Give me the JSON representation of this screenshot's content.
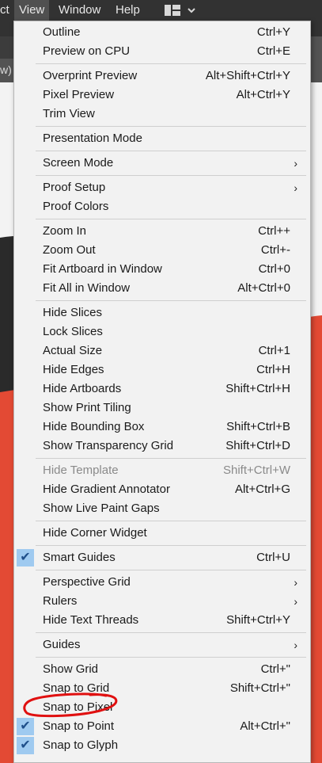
{
  "menubar": {
    "items": [
      "ct",
      "View",
      "Window",
      "Help"
    ],
    "active": "View"
  },
  "tab_strip_fragment": "w)",
  "view_menu": {
    "items": [
      {
        "label": "Outline",
        "shortcut": "Ctrl+Y"
      },
      {
        "label": "Preview on CPU",
        "shortcut": "Ctrl+E"
      },
      {
        "separator": true
      },
      {
        "label": "Overprint Preview",
        "shortcut": "Alt+Shift+Ctrl+Y"
      },
      {
        "label": "Pixel Preview",
        "shortcut": "Alt+Ctrl+Y"
      },
      {
        "label": "Trim View",
        "shortcut": ""
      },
      {
        "separator": true
      },
      {
        "label": "Presentation Mode",
        "shortcut": ""
      },
      {
        "separator": true
      },
      {
        "label": "Screen Mode",
        "submenu": true
      },
      {
        "separator": true
      },
      {
        "label": "Proof Setup",
        "submenu": true
      },
      {
        "label": "Proof Colors",
        "shortcut": ""
      },
      {
        "separator": true
      },
      {
        "label": "Zoom In",
        "shortcut": "Ctrl++"
      },
      {
        "label": "Zoom Out",
        "shortcut": "Ctrl+-"
      },
      {
        "label": "Fit Artboard in Window",
        "shortcut": "Ctrl+0"
      },
      {
        "label": "Fit All in Window",
        "shortcut": "Alt+Ctrl+0"
      },
      {
        "separator": true
      },
      {
        "label": "Hide Slices",
        "shortcut": ""
      },
      {
        "label": "Lock Slices",
        "shortcut": ""
      },
      {
        "label": "Actual Size",
        "shortcut": "Ctrl+1"
      },
      {
        "label": "Hide Edges",
        "shortcut": "Ctrl+H"
      },
      {
        "label": "Hide Artboards",
        "shortcut": "Shift+Ctrl+H"
      },
      {
        "label": "Show Print Tiling",
        "shortcut": ""
      },
      {
        "label": "Hide Bounding Box",
        "shortcut": "Shift+Ctrl+B"
      },
      {
        "label": "Show Transparency Grid",
        "shortcut": "Shift+Ctrl+D"
      },
      {
        "separator": true
      },
      {
        "label": "Hide Template",
        "shortcut": "Shift+Ctrl+W",
        "disabled": true
      },
      {
        "label": "Hide Gradient Annotator",
        "shortcut": "Alt+Ctrl+G"
      },
      {
        "label": "Show Live Paint Gaps",
        "shortcut": ""
      },
      {
        "separator": true
      },
      {
        "label": "Hide Corner Widget",
        "shortcut": ""
      },
      {
        "separator": true
      },
      {
        "label": "Smart Guides",
        "shortcut": "Ctrl+U",
        "checked": true
      },
      {
        "separator": true
      },
      {
        "label": "Perspective Grid",
        "submenu": true
      },
      {
        "label": "Rulers",
        "submenu": true
      },
      {
        "label": "Hide Text Threads",
        "shortcut": "Shift+Ctrl+Y"
      },
      {
        "separator": true
      },
      {
        "label": "Guides",
        "submenu": true
      },
      {
        "separator": true
      },
      {
        "label": "Show Grid",
        "shortcut": "Ctrl+\""
      },
      {
        "label": "Snap to Grid",
        "shortcut": "Shift+Ctrl+\""
      },
      {
        "label": "Snap to Pixel",
        "shortcut": "",
        "annotated": true
      },
      {
        "label": "Snap to Point",
        "shortcut": "Alt+Ctrl+\"",
        "checked": true
      },
      {
        "label": "Snap to Glyph",
        "shortcut": "",
        "checked": true
      }
    ]
  },
  "colors": {
    "menubar_bg": "#323232",
    "menu_bg": "#f2f2f2",
    "check_bg": "#9fcaf0",
    "annotation_stroke": "#e01010",
    "artwork_red": "#e34a34",
    "artwork_dark": "#2a2a2a"
  },
  "icons": {
    "check": "checkmark-icon",
    "submenu": "chevron-right-icon",
    "workspace": "workspace-layout-icon"
  }
}
